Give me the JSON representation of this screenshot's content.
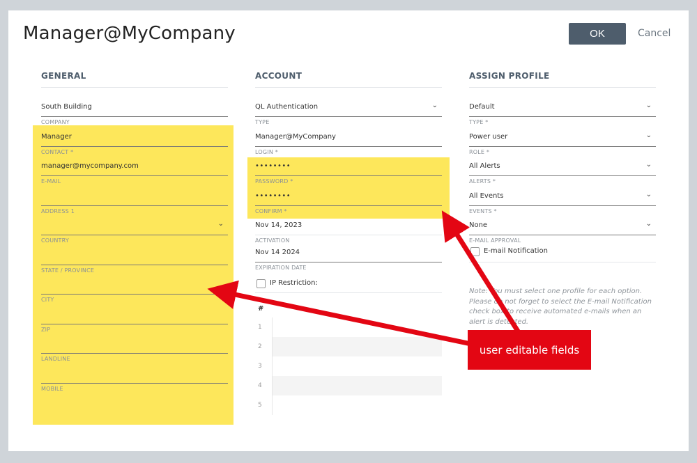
{
  "dialog": {
    "title": "Manager@MyCompany",
    "ok_label": "OK",
    "cancel_label": "Cancel"
  },
  "general": {
    "heading": "GENERAL",
    "fields": [
      {
        "value": "South Building",
        "label": "COMPANY"
      },
      {
        "value": "Manager",
        "label": "CONTACT *"
      },
      {
        "value": "manager@mycompany.com",
        "label": "E-MAIL"
      },
      {
        "value": "",
        "label": "ADDRESS 1"
      },
      {
        "value": "",
        "label": "COUNTRY"
      },
      {
        "value": "",
        "label": "STATE / PROVINCE"
      },
      {
        "value": "",
        "label": "CITY"
      },
      {
        "value": "",
        "label": "ZIP"
      },
      {
        "value": "",
        "label": "LANDLINE"
      },
      {
        "value": "",
        "label": "MOBILE"
      }
    ]
  },
  "account": {
    "heading": "ACCOUNT",
    "fields": [
      {
        "value": "QL Authentication",
        "label": "TYPE"
      },
      {
        "value": "Manager@MyCompany",
        "label": "LOGIN *"
      },
      {
        "value": "••••••••",
        "label": "PASSWORD *"
      },
      {
        "value": "••••••••",
        "label": "CONFIRM *"
      },
      {
        "value": "Nov 14, 2023",
        "label": "ACTIVATION"
      },
      {
        "value": "Nov 14 2024",
        "label": "EXPIRATION DATE"
      }
    ],
    "ip_restriction_label": "IP Restriction:",
    "ip_table": {
      "header": "#",
      "rows": [
        "1",
        "2",
        "3",
        "4",
        "5"
      ]
    }
  },
  "assign_profile": {
    "heading": "ASSIGN PROFILE",
    "fields": [
      {
        "value": "Default",
        "label": "TYPE *"
      },
      {
        "value": "Power user",
        "label": "ROLE *"
      },
      {
        "value": "All Alerts",
        "label": "ALERTS *"
      },
      {
        "value": "All Events",
        "label": "EVENTS *"
      },
      {
        "value": "None",
        "label": "E-MAIL APPROVAL"
      }
    ],
    "email_notification_label": "E-mail Notification",
    "note": "Note: You must select one profile for each option. Please do not forget to select the E-mail Notification check box to receive automated e-mails when an alert is detected."
  },
  "annotation": {
    "text": "user editable fields",
    "color": "#e30613"
  },
  "colors": {
    "highlight": "#fde75b",
    "ok_button": "#4e5d6c"
  }
}
